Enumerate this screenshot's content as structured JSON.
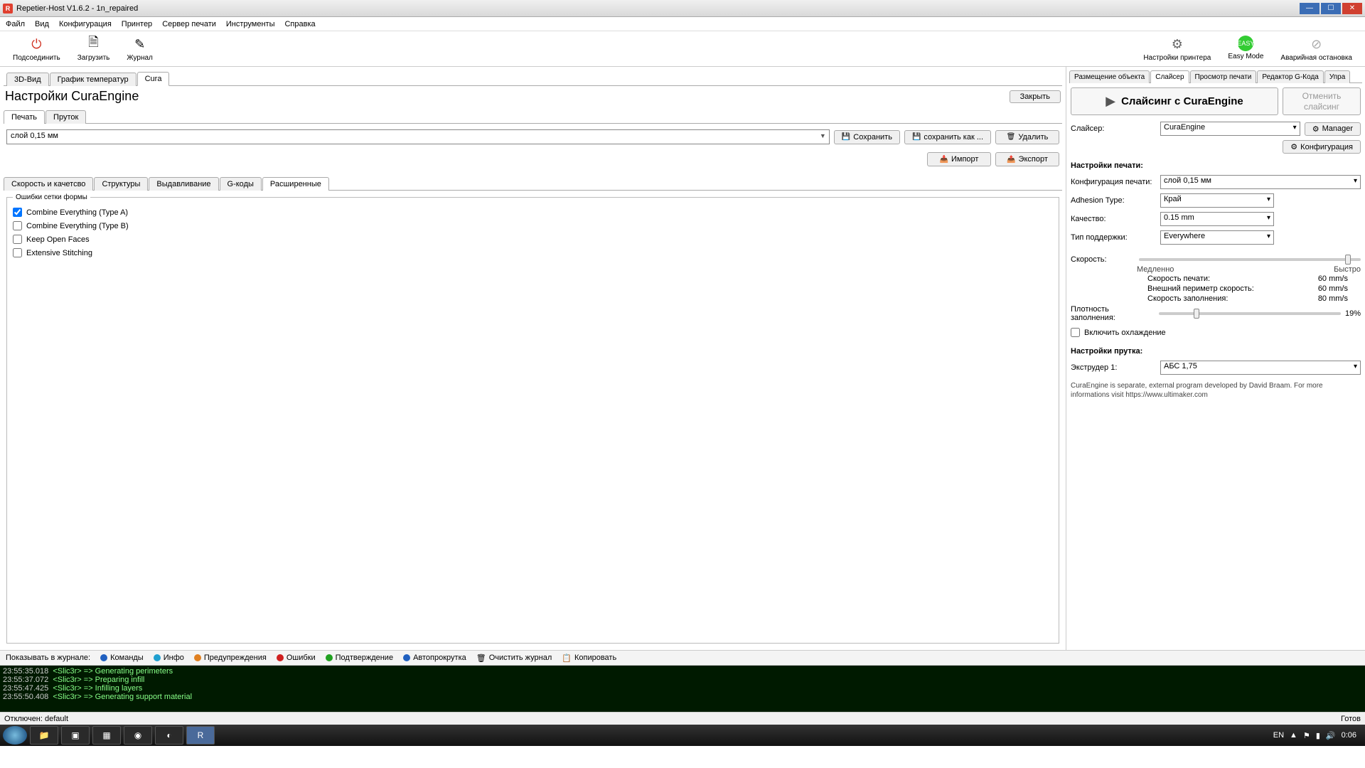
{
  "titlebar": {
    "title": "Repetier-Host V1.6.2 - 1n_repaired"
  },
  "menubar": {
    "items": [
      "Файл",
      "Вид",
      "Конфигурация",
      "Принтер",
      "Сервер печати",
      "Инструменты",
      "Справка"
    ]
  },
  "toolbar": {
    "connect": "Подсоединить",
    "load": "Загрузить",
    "log": "Журнал",
    "printerSettings": "Настройки принтера",
    "easyMode": "Easy Mode",
    "emergency": "Аварийная остановка"
  },
  "leftTabs": {
    "items": [
      "3D-Вид",
      "График температур",
      "Cura"
    ],
    "active": 2
  },
  "page": {
    "title": "Настройки CuraEngine",
    "close": "Закрыть",
    "subTabs": {
      "items": [
        "Печать",
        "Пруток"
      ],
      "active": 0
    },
    "profile": "слой 0,15 мм",
    "save": "Сохранить",
    "saveAs": "сохранить как ...",
    "delete": "Удалить",
    "import": "Импорт",
    "export": "Экспорт",
    "advTabs": {
      "items": [
        "Скорость и качетсво",
        "Структуры",
        "Выдавливание",
        "G-коды",
        "Расширенные"
      ],
      "active": 4
    },
    "fieldsetLegend": "Ошибки сетки формы",
    "checks": [
      {
        "label": "Combine Everything (Type A)",
        "checked": true
      },
      {
        "label": "Combine Everything (Type B)",
        "checked": false
      },
      {
        "label": "Keep Open Faces",
        "checked": false
      },
      {
        "label": "Extensive Stitching",
        "checked": false
      }
    ]
  },
  "rightTabs": {
    "items": [
      "Размещение объекта",
      "Слайсер",
      "Просмотр печати",
      "Редактор G-Кода",
      "Упра"
    ],
    "active": 1
  },
  "slicer": {
    "sliceBtn": "Слайсинг с CuraEngine",
    "cancelBtn": "Отменить слайсинг",
    "slicerLabel": "Слайсер:",
    "slicerValue": "CuraEngine",
    "manager": "Manager",
    "configBtn": "Конфигурация",
    "printSettingsHead": "Настройки печати:",
    "configLabel": "Конфигурация печати:",
    "configValue": "слой 0,15 мм",
    "adhesionLabel": "Adhesion Type:",
    "adhesionValue": "Край",
    "qualityLabel": "Качество:",
    "qualityValue": "0.15 mm",
    "supportLabel": "Тип поддержки:",
    "supportValue": "Everywhere",
    "speedLabel": "Скорость:",
    "slow": "Медленно",
    "fast": "Быстро",
    "printSpeedLabel": "Скорость печати:",
    "printSpeedValue": "60 mm/s",
    "perimSpeedLabel": "Внешний периметр скорость:",
    "perimSpeedValue": "60 mm/s",
    "infillSpeedLabel": "Скорость заполнения:",
    "infillSpeedValue": "80 mm/s",
    "densityLabel": "Плотность заполнения:",
    "densityValue": "19%",
    "cooling": "Включить охлаждение",
    "filamentHead": "Настройки прутка:",
    "extruderLabel": "Экструдер 1:",
    "extruderValue": "АБС 1,75",
    "note": "CuraEngine is separate, external program developed by David Braam. For more informations visit https://www.ultimaker.com"
  },
  "logFilter": {
    "label": "Показывать в журнале:",
    "commands": "Команды",
    "info": "Инфо",
    "warnings": "Предупреждения",
    "errors": "Ошибки",
    "ack": "Подтверждение",
    "autoscroll": "Автопрокрутка",
    "clear": "Очистить журнал",
    "copy": "Копировать"
  },
  "log": [
    {
      "ts": "23:55:35.018",
      "text": "<Slic3r> => Generating perimeters"
    },
    {
      "ts": "23:55:37.072",
      "text": "<Slic3r> => Preparing infill"
    },
    {
      "ts": "23:55:47.425",
      "text": "<Slic3r> => Infilling layers"
    },
    {
      "ts": "23:55:50.408",
      "text": "<Slic3r> => Generating support material"
    }
  ],
  "status": {
    "left": "Отключен: default",
    "right": "Готов"
  },
  "tray": {
    "lang": "EN",
    "time": "0:06"
  }
}
